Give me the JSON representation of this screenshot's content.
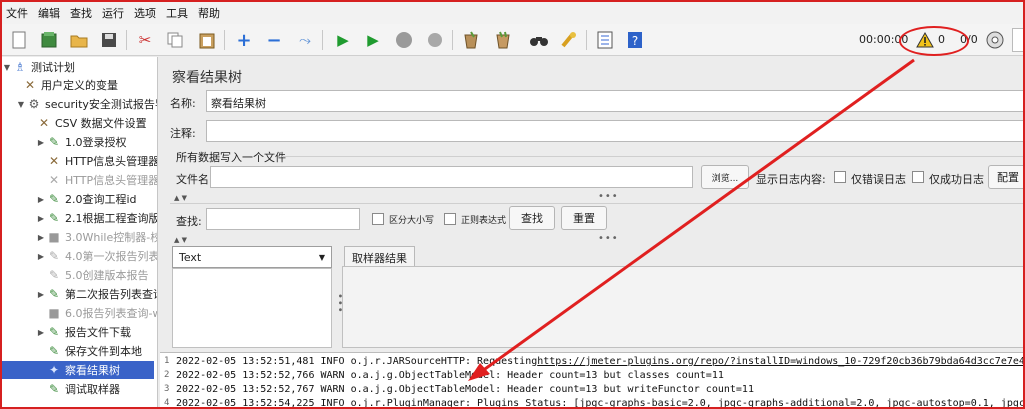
{
  "menu": [
    "文件",
    "编辑",
    "查找",
    "运行",
    "选项",
    "工具",
    "帮助"
  ],
  "toolbar": {
    "icons": [
      "new-icon",
      "templates-icon",
      "open-icon",
      "save-icon",
      "cut-icon",
      "copy-icon",
      "paste-icon",
      "expand-icon",
      "collapse-icon",
      "toggle-icon",
      "start-icon",
      "start-no-pause-icon",
      "stop-icon",
      "shutdown-icon",
      "clear-icon",
      "clear-all-icon",
      "search-icon",
      "reset-search-icon",
      "function-helper-icon",
      "help-icon"
    ],
    "elapsed": "00:00:00",
    "warning_count": "0",
    "threads": "0/0"
  },
  "tree": {
    "items": [
      {
        "label": "测试计划",
        "icon": "test-plan-icon",
        "arrow": "▼"
      },
      {
        "label": "用户定义的变量",
        "icon": "tools-icon",
        "arrow": ""
      },
      {
        "label": "security安全测试报告导",
        "icon": "gear-icon",
        "arrow": "▼"
      },
      {
        "label": "CSV 数据文件设置",
        "icon": "tools-icon",
        "arrow": ""
      },
      {
        "label": "1.0登录授权",
        "icon": "pen-icon",
        "arrow": "▶"
      },
      {
        "label": "HTTP信息头管理器",
        "icon": "tools-icon",
        "arrow": ""
      },
      {
        "label": "HTTP信息头管理器",
        "icon": "tools-icon",
        "arrow": ""
      },
      {
        "label": "2.0查询工程id",
        "icon": "pen-icon",
        "arrow": "▶"
      },
      {
        "label": "2.1根据工程查询版",
        "icon": "pen-icon",
        "arrow": "▶"
      },
      {
        "label": "3.0While控制器-校",
        "icon": "controller-icon",
        "arrow": "▶"
      },
      {
        "label": "4.0第一次报告列表",
        "icon": "pen-icon",
        "arrow": "▶"
      },
      {
        "label": "5.0创建版本报告",
        "icon": "pen-icon",
        "arrow": ""
      },
      {
        "label": "第二次报告列表查询",
        "icon": "pen-icon",
        "arrow": "▶"
      },
      {
        "label": "6.0报告列表查询-w",
        "icon": "controller-icon",
        "arrow": ""
      },
      {
        "label": "报告文件下载",
        "icon": "pen-icon",
        "arrow": "▶"
      },
      {
        "label": "保存文件到本地",
        "icon": "pen-icon",
        "arrow": ""
      },
      {
        "label": "察看结果树",
        "icon": "chart-icon",
        "arrow": ""
      },
      {
        "label": "调试取样器",
        "icon": "pen-icon",
        "arrow": ""
      }
    ]
  },
  "panel": {
    "title": "察看结果树",
    "name_label": "名称:",
    "name_value": "察看结果树",
    "comment_label": "注释:",
    "section_title": "所有数据写入一个文件",
    "filename_label": "文件名",
    "browse_button": "浏览...",
    "log_content_label": "显示日志内容:",
    "errors_only": "仅错误日志",
    "success_only": "仅成功日志",
    "configure_button": "配置",
    "search_label": "查找:",
    "case_sensitive": "区分大小写",
    "regex": "正则表达式",
    "find_button": "查找",
    "reset_button": "重置",
    "renderer_selected": "Text",
    "result_tab": "取样器结果"
  },
  "log": {
    "lines": [
      {
        "num": "1",
        "pre": "2022-02-05 13:52:51,481 INFO o.j.r.JARSourceHTTP: Requesting ",
        "url": "https://jmeter-plugins.org/repo/?installID=windows_10-729f20cb36b79bda64d3cc7e7e46c88b"
      },
      {
        "num": "2",
        "pre": "2022-02-05 13:52:52,766 WARN o.a.j.g.ObjectTableModel: Header count=13 but classes count=11",
        "url": ""
      },
      {
        "num": "3",
        "pre": "2022-02-05 13:52:52,767 WARN o.a.j.g.ObjectTableModel: Header count=13 but writeFunctor count=11",
        "url": ""
      },
      {
        "num": "4",
        "pre": "2022-02-05 13:52:54,225 INFO o.j.r.PluginManager: Plugins Status: [jpgc-graphs-basic=2.0, jpgc-graphs-additional=2.0, jpgc-autostop=0.1, jpgc-cmd=2",
        "url": ""
      }
    ]
  },
  "colors": {
    "annotation": "#e02020",
    "selection": "#3a63c8"
  }
}
